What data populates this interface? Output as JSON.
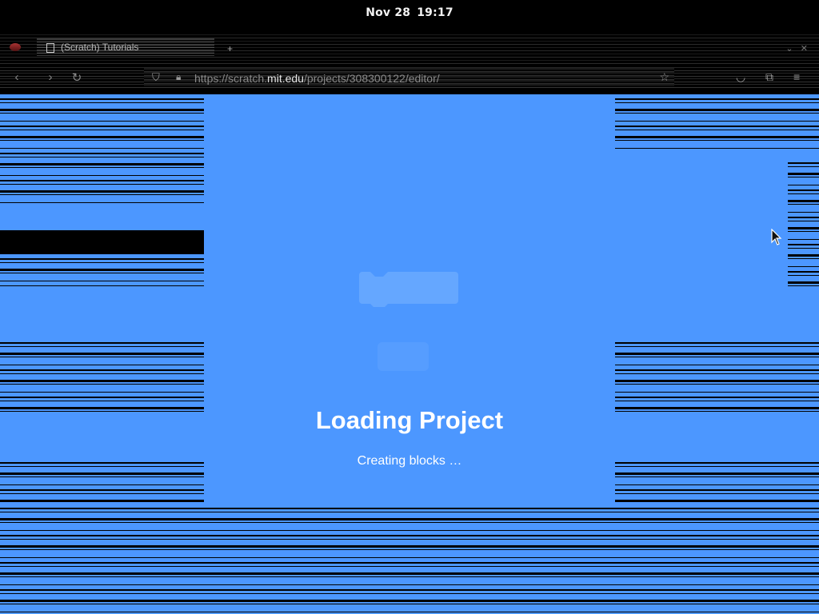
{
  "system_bar": {
    "date": "Nov 28",
    "time": "19:17"
  },
  "browser": {
    "tab": {
      "title": "(Scratch) Tutorials"
    },
    "url": {
      "prefix": "https://scratch.",
      "host": "mit.edu",
      "path": "/projects/308300122/editor/"
    },
    "icons": {
      "back": "back-arrow-icon",
      "forward": "forward-arrow-icon",
      "reload": "reload-icon",
      "shield": "tracking-shield-icon",
      "lock": "lock-icon",
      "star": "bookmark-star-icon",
      "pocket": "pocket-icon",
      "extensions": "extensions-icon",
      "menu": "hamburger-menu-icon"
    }
  },
  "loader": {
    "title": "Loading Project",
    "status": "Creating blocks …"
  },
  "colors": {
    "scratch_blue": "#4c97ff",
    "block_light": "#6aa9ff"
  }
}
